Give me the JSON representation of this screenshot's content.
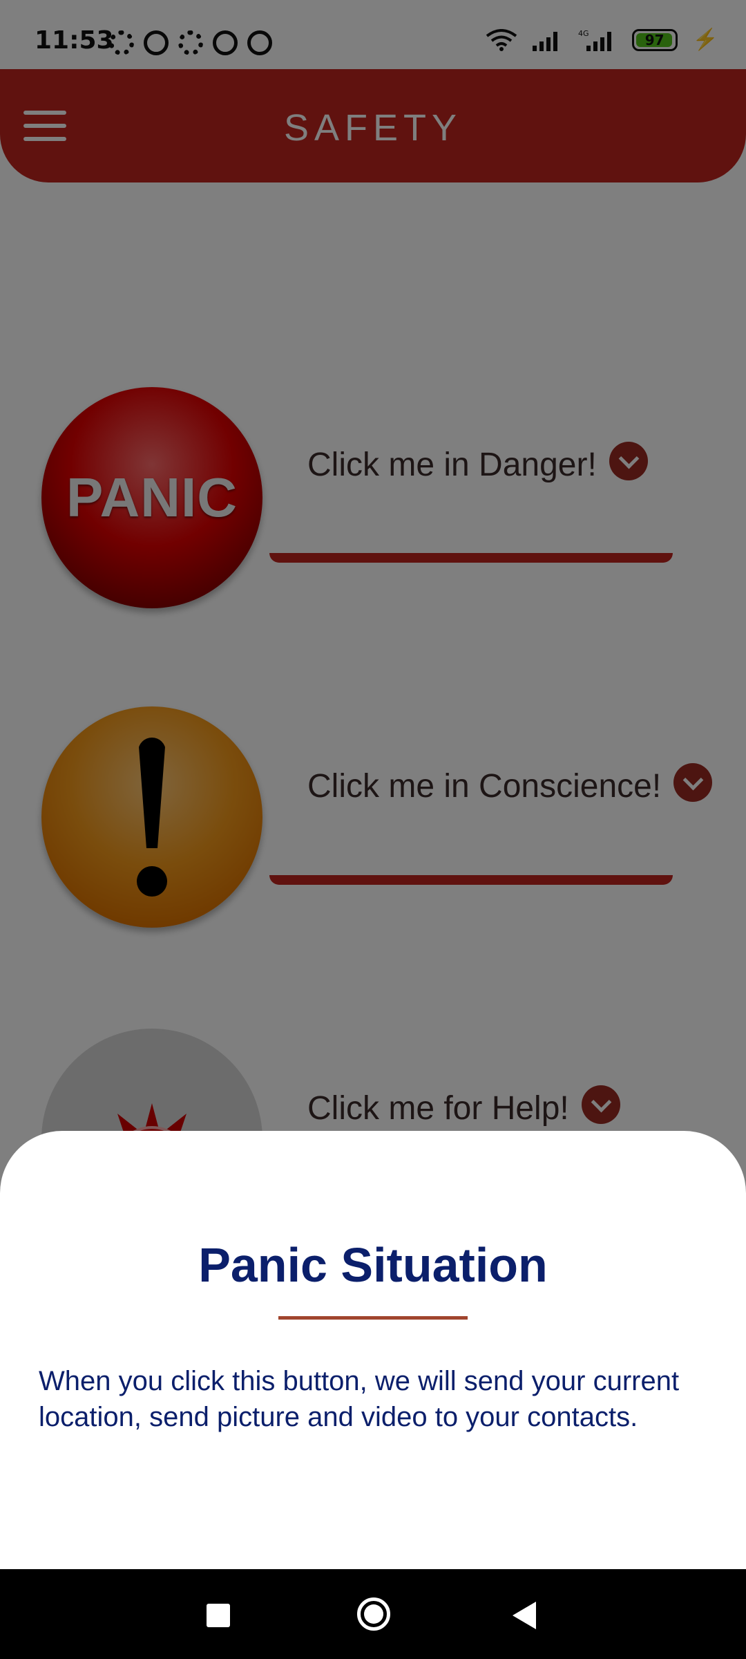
{
  "status_bar": {
    "time": "11:53",
    "battery_level": "97",
    "network": "4G"
  },
  "header": {
    "title": "SAFETY"
  },
  "actions": [
    {
      "button_text": "PANIC",
      "label": "Click me in Danger!"
    },
    {
      "label": "Click me in Conscience!"
    },
    {
      "label": "Click me for Help!"
    }
  ],
  "sheet": {
    "title": "Panic Situation",
    "body": "When you click this button, we will send your current location, send picture and video to your contacts."
  },
  "colors": {
    "header": "#c1251f",
    "sheet_title": "#0b1f6b",
    "divider": "#a0452e"
  }
}
